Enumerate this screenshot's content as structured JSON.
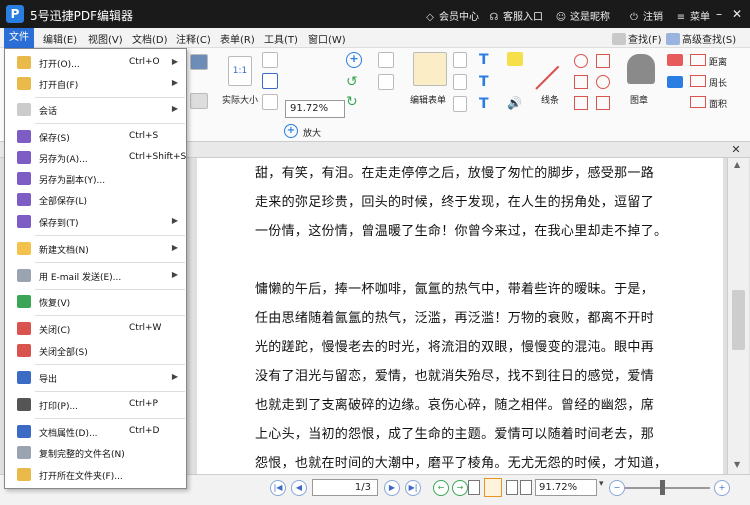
{
  "app": {
    "title": "5号迅捷PDF编辑器",
    "logo": "P"
  },
  "titlebar": {
    "member": "会员中心",
    "support": "客服入口",
    "user": "这是昵称",
    "logout": "注销",
    "menu": "菜单"
  },
  "menubar": {
    "items": [
      "文件",
      "编辑(E)",
      "视图(V)",
      "文档(D)",
      "注释(C)",
      "表单(R)",
      "工具(T)",
      "窗口(W)"
    ],
    "find": "查找(F)",
    "advanced_find": "高级查找(S)"
  },
  "ribbon": {
    "actual_size": "实际大小",
    "zoom_value": "91.72%",
    "zoom_in": "放大",
    "zoom_out": "缩小",
    "edit_form": "编辑表单",
    "line": "线条",
    "stamp": "图章",
    "distance": "距离",
    "perimeter": "周长",
    "area": "面积"
  },
  "file_menu": [
    {
      "label": "打开(O)...",
      "shortcut": "Ctrl+O",
      "arrow": "▶",
      "icon": "folder-open-icon",
      "color": "#e9b949"
    },
    {
      "label": "打开自(F)",
      "shortcut": "",
      "arrow": "▶",
      "icon": "folder-from-icon",
      "color": "#e9b949"
    },
    {
      "label": "会话",
      "shortcut": "",
      "arrow": "▶",
      "icon": "session-icon",
      "color": "#cccccc"
    },
    {
      "label": "保存(S)",
      "shortcut": "Ctrl+S",
      "arrow": "",
      "icon": "save-icon",
      "color": "#7e5cc6"
    },
    {
      "label": "另存为(A)...",
      "shortcut": "Ctrl+Shift+S",
      "arrow": "",
      "icon": "save-as-icon",
      "color": "#7e5cc6"
    },
    {
      "label": "另存为副本(Y)...",
      "shortcut": "",
      "arrow": "",
      "icon": "save-copy-icon",
      "color": "#7e5cc6"
    },
    {
      "label": "全部保存(L)",
      "shortcut": "",
      "arrow": "",
      "icon": "save-all-icon",
      "color": "#7e5cc6"
    },
    {
      "label": "保存到(T)",
      "shortcut": "",
      "arrow": "▶",
      "icon": "save-to-icon",
      "color": "#7e5cc6"
    },
    {
      "label": "新建文档(N)",
      "shortcut": "",
      "arrow": "▶",
      "icon": "new-document-icon",
      "color": "#f2c14e"
    },
    {
      "label": "用 E-mail 发送(E)...",
      "shortcut": "",
      "arrow": "▶",
      "icon": "email-icon",
      "color": "#9aa3b0"
    },
    {
      "label": "恢复(V)",
      "shortcut": "",
      "arrow": "",
      "icon": "restore-icon",
      "color": "#3aa655"
    },
    {
      "label": "关闭(C)",
      "shortcut": "Ctrl+W",
      "arrow": "",
      "icon": "close-doc-icon",
      "color": "#d9534f"
    },
    {
      "label": "关闭全部(S)",
      "shortcut": "",
      "arrow": "",
      "icon": "close-all-icon",
      "color": "#d9534f"
    },
    {
      "label": "导出",
      "shortcut": "",
      "arrow": "▶",
      "icon": "export-icon",
      "color": "#3b6bc5"
    },
    {
      "label": "打印(P)...",
      "shortcut": "Ctrl+P",
      "arrow": "",
      "icon": "print-icon",
      "color": "#555555"
    },
    {
      "label": "文档属性(D)...",
      "shortcut": "Ctrl+D",
      "arrow": "",
      "icon": "properties-icon",
      "color": "#3b6bc5"
    },
    {
      "label": "复制完整的文件名(N)",
      "shortcut": "",
      "arrow": "",
      "icon": "copy-filename-icon",
      "color": "#9aa3b0"
    },
    {
      "label": "打开所在文件夹(F)...",
      "shortcut": "",
      "arrow": "",
      "icon": "open-folder-icon",
      "color": "#e9b949"
    }
  ],
  "document": {
    "lines": [
      "甜，有笑，有泪。在走走停停之后，放慢了匆忙的脚步，感受那一路",
      "走来的弥足珍贵，回头的时候，终于发现，在人生的拐角处，逗留了",
      "一份情，这份情，曾温暖了生命！你曾今来过，在我心里却走不掉了。",
      "",
      "慵懒的午后，捧一杯咖啡，氤氲的热气中，带着些许的暧昧。于是，",
      "任由思绪随着氤氲的热气，泛滥，再泛滥！万物的衰败，都离不开时",
      "光的蹉跎，慢慢老去的时光，将流泪的双眼，慢慢变的混沌。眼中再",
      "没有了泪光与留恋，爱情，也就消失殆尽，找不到往日的感觉，爱情",
      "也就走到了支离破碎的边缘。哀伤心碎，随之相伴。曾经的幽怨，席",
      "上心头，当初的怨恨，成了生命的主题。爱情可以随着时间老去，那",
      "怨恨，也就在时间的大潮中，磨平了棱角。无尤无怨的时候，才知道，"
    ]
  },
  "status": {
    "page": "1",
    "total": "/3",
    "zoom": "91.72%"
  }
}
